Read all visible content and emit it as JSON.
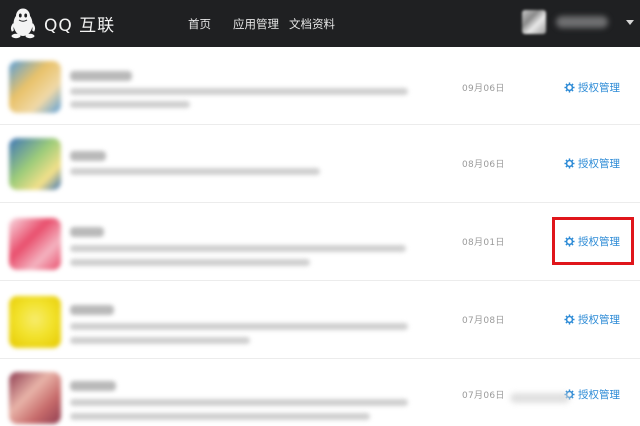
{
  "header": {
    "brand": "QQ 互联",
    "nav": [
      {
        "label": "首页"
      },
      {
        "label": "应用管理"
      },
      {
        "label": "文档资料"
      }
    ]
  },
  "apps": [
    {
      "date": "09月06日",
      "action": "授权管理",
      "icon_colors": [
        "#e9c26a",
        "#5b9fd8",
        "#f0d9a8"
      ]
    },
    {
      "date": "08月06日",
      "action": "授权管理",
      "icon_colors": [
        "#3f76b9",
        "#9dcc7a",
        "#f3e08a"
      ]
    },
    {
      "date": "08月01日",
      "action": "授权管理",
      "icon_colors": [
        "#e94f6d",
        "#f4b3c0",
        "#f8dbe2"
      ]
    },
    {
      "date": "07月08日",
      "action": "授权管理",
      "icon_colors": [
        "#f2e22c",
        "#f7ec6c",
        "#e6c900"
      ]
    },
    {
      "date": "07月06日",
      "action": "授权管理",
      "icon_colors": [
        "#c66a6a",
        "#e8b3a8",
        "#8f3e52"
      ]
    }
  ],
  "colors": {
    "header_bg": "#1f2022",
    "link": "#2d8bd6",
    "highlight": "#e0161b"
  }
}
